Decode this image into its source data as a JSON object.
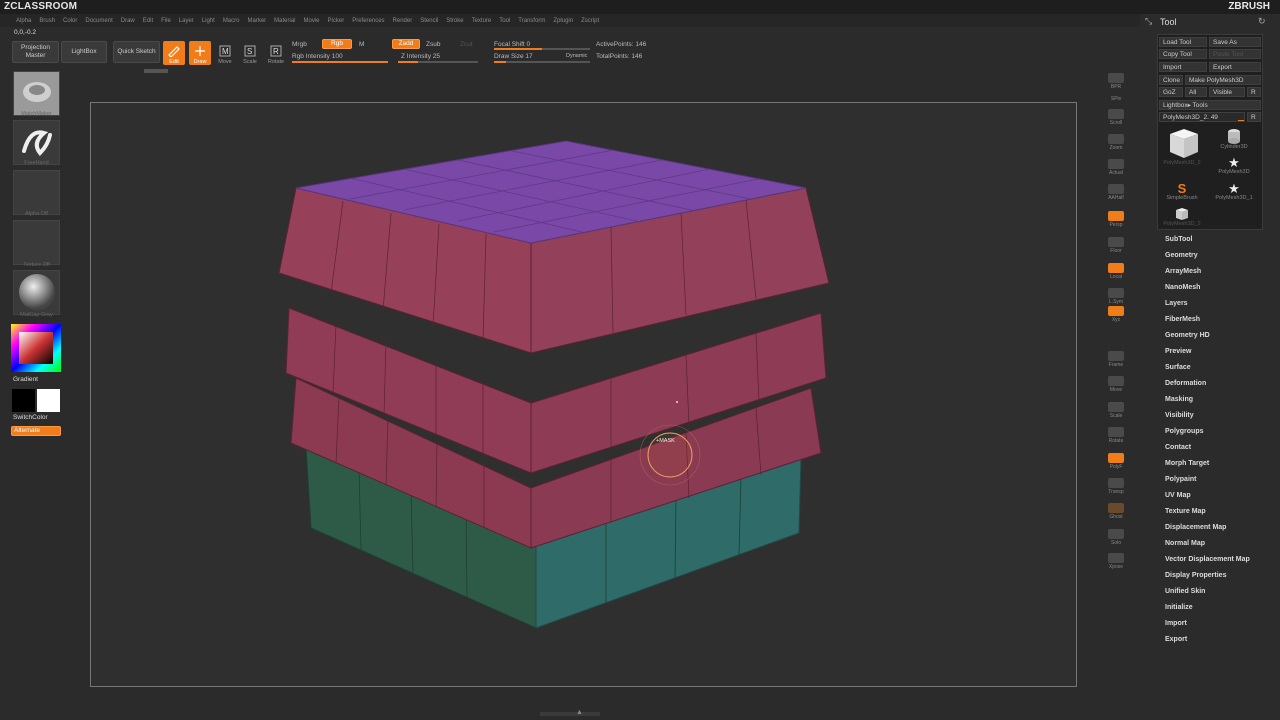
{
  "window": {
    "brand_left": "ZCLASSROOM",
    "brand_right": "ZBRUSH"
  },
  "menu": [
    "Alpha",
    "Brush",
    "Color",
    "Document",
    "Draw",
    "Edit",
    "File",
    "Layer",
    "Light",
    "Macro",
    "Marker",
    "Material",
    "Movie",
    "Picker",
    "Preferences",
    "Render",
    "Stencil",
    "Stroke",
    "Texture",
    "Tool",
    "Transform",
    "Zplugin",
    "Zscript"
  ],
  "toolbar": {
    "coords": "0,0,-0.2",
    "projection_master": "Projection Master",
    "lightbox": "LightBox",
    "quick_sketch": "Quick Sketch",
    "edit": "Edit",
    "draw": "Draw",
    "move": "Move",
    "scale": "Scale",
    "rotate": "Rotate",
    "mrgb": "Mrgb",
    "rgb": "Rgb",
    "m": "M",
    "rgb_intensity_label": "Rgb Intensity 100",
    "rgb_intensity_value": 100,
    "zadd": "Zadd",
    "zsub": "Zsub",
    "zcut": "Zcut",
    "z_intensity_label": "Z Intensity 25",
    "z_intensity_value": 25,
    "focal_shift_label": "Focal Shift 0",
    "focal_shift_value": 0,
    "draw_size_label": "Draw Size 17",
    "draw_size_value": 17,
    "dynamic": "Dynamic",
    "active_points": "ActivePoints: 146",
    "total_points": "TotalPoints: 146"
  },
  "left_shelf": {
    "brush_label": "MatchMaker",
    "stroke_label": "FreeHand",
    "alpha_label": "Alpha Off",
    "texture_label": "Texture Off",
    "material_label": "MatCap Gray",
    "gradient": "Gradient",
    "switch_color": "SwitchColor",
    "alternate": "Alternate"
  },
  "viewport": {
    "cursor_label": "+MASK",
    "colors": {
      "top": "#7a4aa8",
      "sides": "#9a3a55",
      "base": "#2d5a4a",
      "accent": "#f07c1a"
    }
  },
  "right_shelf": [
    "BPR",
    "SPix",
    "Scroll",
    "Zoom",
    "Actual",
    "AAHalf",
    "Persp",
    "Floor",
    "Local",
    "L.Sym",
    "Xyz",
    "Frame",
    "Move",
    "Scale",
    "Rotate",
    "PolyF",
    "Transp",
    "Ghost",
    "Solo",
    "Xpose"
  ],
  "tool_panel": {
    "title": "Tool",
    "buttons": {
      "load_tool": "Load Tool",
      "save_as": "Save As",
      "copy_tool": "Copy Tool",
      "paste_tool": "Paste Tool",
      "import": "Import",
      "export": "Export",
      "clone": "Clone",
      "make_polymesh": "Make PolyMesh3D",
      "goz": "GoZ",
      "all": "All",
      "visible": "Visible",
      "r": "R",
      "lightbox_tools": "Lightbox▸ Tools",
      "current_tool": "PolyMesh3D_2. 49",
      "r2": "R"
    },
    "thumbs": {
      "main": "PolyMesh3D_2",
      "cylinder": "Cylinder3D",
      "polymesh": "PolyMesh3D",
      "simplebrush": "SimpleBrush",
      "polymesh_1": "PolyMesh3D_1",
      "polymesh_2": "PolyMesh3D_2"
    },
    "subpalettes": [
      "SubTool",
      "Geometry",
      "ArrayMesh",
      "NanoMesh",
      "Layers",
      "FiberMesh",
      "Geometry HD",
      "Preview",
      "Surface",
      "Deformation",
      "Masking",
      "Visibility",
      "Polygroups",
      "Contact",
      "Morph Target",
      "Polypaint",
      "UV Map",
      "Texture Map",
      "Displacement Map",
      "Normal Map",
      "Vector Displacement Map",
      "Display Properties",
      "Unified Skin",
      "Initialize",
      "Import",
      "Export"
    ]
  }
}
